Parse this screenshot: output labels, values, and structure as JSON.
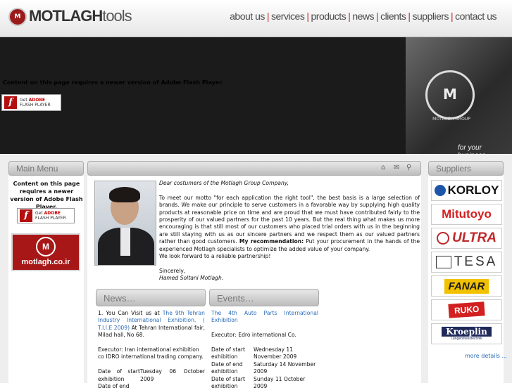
{
  "brand": {
    "name_bold": "MOTLAGH",
    "name_light": "tools",
    "emblem_glyph": "M"
  },
  "nav": [
    {
      "label": "about us"
    },
    {
      "label": "services"
    },
    {
      "label": "products"
    },
    {
      "label": "news"
    },
    {
      "label": "clients"
    },
    {
      "label": "suppliers"
    },
    {
      "label": "contact us"
    }
  ],
  "flash": {
    "message": "Content on this page requires a newer version of Adobe Flash Player.",
    "get": "Get",
    "adobe": "ADOBE",
    "product": "FLASH PLAYER",
    "icon_glyph": "f"
  },
  "banner": {
    "emblem_caption": "MOTLAGH GROUP",
    "tagline": "for your business..."
  },
  "left": {
    "heading": "Main Menu",
    "flash_message": "Content on this page requires a newer version of Adobe Flash Player.",
    "site_badge": "motlagh.co.ir"
  },
  "letter": {
    "greeting": "Dear costumers of the Motlagh Group Company,",
    "body1": "To meet our motto \"for each application the right tool\", the best basis is a large selection of brands. We make our principle to serve customers in a favorable way by supplying high quality products at reasonable price on time and are proud that we must have contributed fairly to the prosperity of our valued partners for the past 10 years. But the real thing what makes us more encouraging is that still most of our customers who placed trial orders with us in the beginning are still staying with us as our sincere partners and we respect them as our valued partners rather than good customers.",
    "rec_label": "My recommendation:",
    "rec_text": "Put your procurement in the hands of the experienced Motlagh specialists to optimize the added value of your company.",
    "closing_line": "We look forward to a reliable partnership!",
    "sincerely": "Sincerely,",
    "signature": "Hamed Soltani Motlagh."
  },
  "news": {
    "heading": "News…",
    "item_prefix": "1. You Can Visit us at",
    "item_link": "The 9th Tehran Industry International Exhibition. ( T.I.I.E 2009)",
    "item_rest": "At Tehran International fair, Milad hall, No 68.",
    "executor": "Executor: Iran international exhibition co IDRO international trading company.",
    "rows": [
      {
        "k": "Date of start exhibition",
        "v": "Tuesday 06 October 2009"
      },
      {
        "k": "Date of end",
        "v": ""
      }
    ]
  },
  "events": {
    "heading": "Events…",
    "title_link": "The 4th Auto Parts International Exhibition",
    "executor": "Executor: Edro international Co.",
    "rows": [
      {
        "k": "Date of start exhibition",
        "v": "Wednesday 11 November 2009"
      },
      {
        "k": "Date of end exhibition",
        "v": "Saturday 14 November 2009"
      },
      {
        "k": "Date of start exhibition",
        "v": "Sunday 11 October 2009"
      }
    ]
  },
  "suppliers": {
    "heading": "Suppliers",
    "brands": [
      "KORLOY",
      "Mitutoyo",
      "ULTRA",
      "TESA",
      "FANAR",
      "RUKO",
      "Kroeplin"
    ],
    "kroeplin_sub": "Längenmesstechnik",
    "more": "more details ..."
  },
  "colors": {
    "accent_red": "#c0282b",
    "link_blue": "#2a6bb8",
    "banner_dark": "#1b1b1b"
  }
}
